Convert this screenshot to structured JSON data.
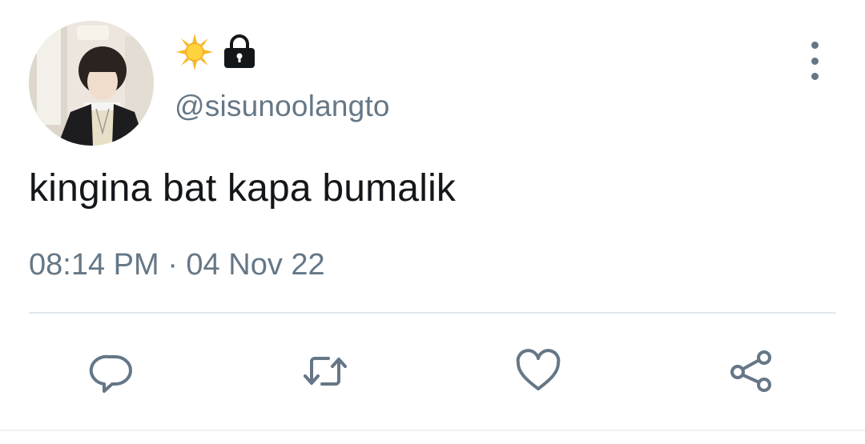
{
  "header": {
    "emoji_icon": "sun-icon",
    "lock_icon": "lock-icon",
    "handle": "@sisunoolangto"
  },
  "tweet": {
    "text": "kingina bat kapa bumalik",
    "timestamp": "08:14 PM · 04 Nov 22"
  },
  "actions": [
    {
      "name": "reply",
      "icon": "comment-icon"
    },
    {
      "name": "retweet",
      "icon": "retweet-icon"
    },
    {
      "name": "like",
      "icon": "heart-icon"
    },
    {
      "name": "share",
      "icon": "share-icon"
    }
  ],
  "colors": {
    "text_primary": "#14171a",
    "text_secondary": "#657786",
    "divider": "#e1e8ed",
    "background": "#ffffff"
  }
}
